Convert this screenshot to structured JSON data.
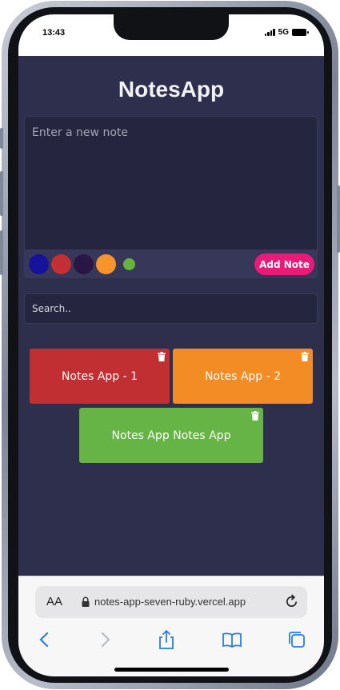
{
  "status": {
    "time": "13:43",
    "network": "5G"
  },
  "app": {
    "title": "NotesApp",
    "editor": {
      "placeholder": "Enter a new note",
      "add_button_label": "Add Note",
      "swatches": [
        {
          "name": "dark-blue",
          "color": "#16129c"
        },
        {
          "name": "red",
          "color": "#c32f33"
        },
        {
          "name": "dark-purple",
          "color": "#2a1644"
        },
        {
          "name": "orange",
          "color": "#f7952c"
        },
        {
          "name": "green",
          "color": "#66b33f"
        }
      ]
    },
    "search": {
      "placeholder": "Search.."
    },
    "notes": [
      {
        "text": "Notes App - 1",
        "color": "#c12f33"
      },
      {
        "text": "Notes App - 2",
        "color": "#f48c25"
      },
      {
        "text": "Notes App Notes App",
        "color": "#67b446"
      }
    ]
  },
  "browser": {
    "aa_label": "AA",
    "url": "notes-app-seven-ruby.vercel.app"
  },
  "colors": {
    "app_background": "#2e2e4d",
    "editor_background": "#25253f",
    "editor_bar": "#37375a",
    "accent_button": "#ea1a78"
  }
}
